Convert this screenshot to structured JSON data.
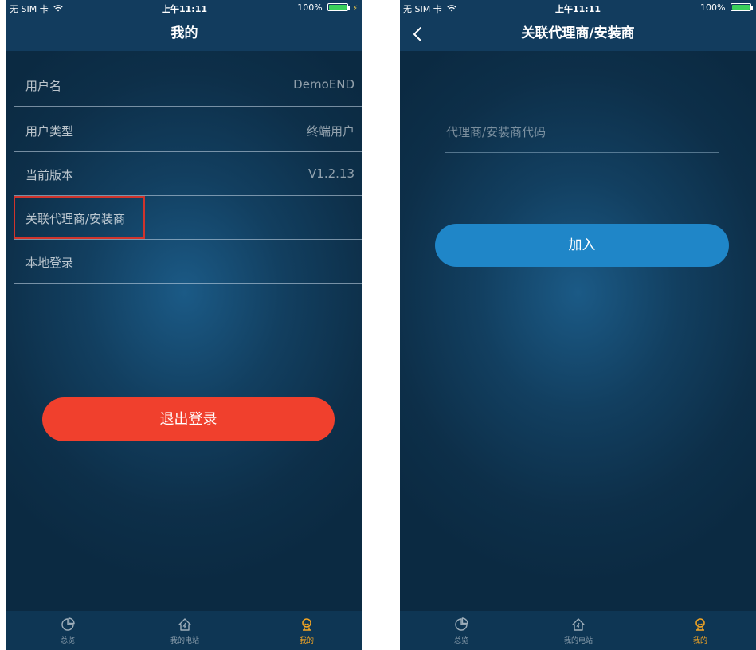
{
  "status_bar": {
    "carrier": "无 SIM 卡",
    "time": "上午11:11",
    "battery": "100%",
    "battery_level": 1.0
  },
  "profile_screen": {
    "title": "我的",
    "rows": [
      {
        "label": "用户名",
        "value": "DemoEND"
      },
      {
        "label": "用户类型",
        "value": "终端用户"
      },
      {
        "label": "当前版本",
        "value": "V1.2.13"
      },
      {
        "label": "关联代理商/安装商",
        "value": ""
      },
      {
        "label": "本地登录",
        "value": ""
      }
    ],
    "logout_label": "退出登录"
  },
  "link_screen": {
    "title": "关联代理商/安装商",
    "back_icon": "chevron-left-icon",
    "input_value": "",
    "input_placeholder": "代理商/安装商代码",
    "join_label": "加入"
  },
  "tab_bar": {
    "tabs": [
      {
        "label": "总览",
        "icon": "pie-chart-icon",
        "active": false
      },
      {
        "label": "我的电站",
        "icon": "power-station-icon",
        "active": false
      },
      {
        "label": "我的",
        "icon": "user-icon",
        "active": true
      }
    ]
  },
  "colors": {
    "background_dark": "#0b2a42",
    "nav_bar": "#123c5e",
    "logout_button": "#f0402d",
    "join_button": "#1f86c8",
    "active_tab": "#f5a623",
    "highlight": "#d0342c"
  }
}
